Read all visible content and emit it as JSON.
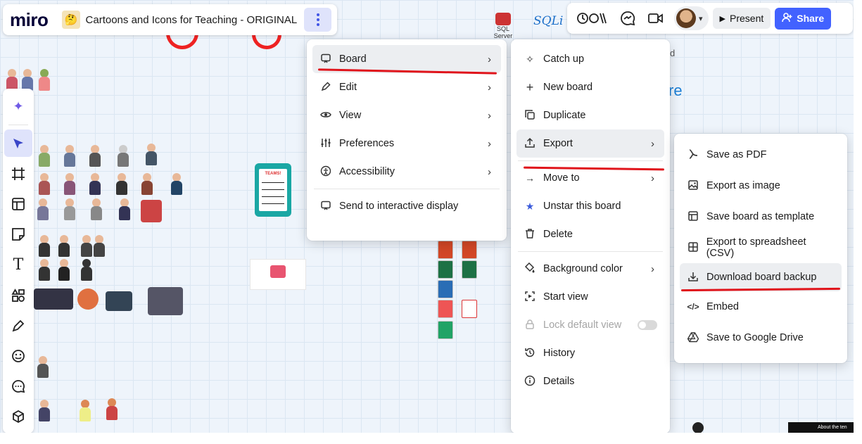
{
  "app": {
    "logo": "miro",
    "board_title": "Cartoons and Icons for Teaching - ORIGINAL"
  },
  "topbar": {
    "reactions_icon": "reactions-icon",
    "present_label": "Present",
    "share_label": "Share"
  },
  "canvas_texts": {
    "sql_server": "SQL Server",
    "sqlite": "SQLi",
    "fragment_re": "re",
    "fragment_d": "d",
    "clipboard_label": "TEAMS!",
    "footer_fragment": "About the ten"
  },
  "board_menu": {
    "items": [
      {
        "label": "Board",
        "icon": "board-icon",
        "chevron": true
      },
      {
        "label": "Edit",
        "icon": "edit-icon",
        "chevron": true
      },
      {
        "label": "View",
        "icon": "view-icon",
        "chevron": true
      },
      {
        "label": "Preferences",
        "icon": "preferences-icon",
        "chevron": true
      },
      {
        "label": "Accessibility",
        "icon": "accessibility-icon",
        "chevron": true
      },
      {
        "label": "Send to interactive display",
        "icon": "display-icon",
        "chevron": false
      }
    ]
  },
  "board_submenu": {
    "items": [
      {
        "label": "Catch up",
        "icon": "sparkle-icon"
      },
      {
        "label": "New board",
        "icon": "plus-icon"
      },
      {
        "label": "Duplicate",
        "icon": "duplicate-icon"
      },
      {
        "label": "Export",
        "icon": "export-icon"
      },
      {
        "label": "Move to",
        "icon": "move-icon"
      },
      {
        "label": "Unstar this board",
        "icon": "star-icon"
      },
      {
        "label": "Delete",
        "icon": "trash-icon"
      },
      {
        "label": "Background color",
        "icon": "paint-bucket-icon"
      },
      {
        "label": "Start view",
        "icon": "start-view-icon"
      },
      {
        "label": "Lock default view",
        "icon": "lock-icon"
      },
      {
        "label": "History",
        "icon": "history-icon"
      },
      {
        "label": "Details",
        "icon": "info-icon"
      }
    ]
  },
  "export_submenu": {
    "items": [
      {
        "label": "Save as PDF",
        "icon": "pdf-icon"
      },
      {
        "label": "Export as image",
        "icon": "image-icon"
      },
      {
        "label": "Save board as template",
        "icon": "template-icon"
      },
      {
        "label": "Export to spreadsheet (CSV)",
        "icon": "spreadsheet-icon"
      },
      {
        "label": "Download board backup",
        "icon": "download-icon"
      },
      {
        "label": "Embed",
        "icon": "embed-icon"
      },
      {
        "label": "Save to Google Drive",
        "icon": "google-drive-icon"
      }
    ]
  },
  "colors": {
    "accent": "#4262ff",
    "highlight_bg": "#eceef1",
    "annotation_red": "#e0141b",
    "star": "#3b5bdb"
  }
}
